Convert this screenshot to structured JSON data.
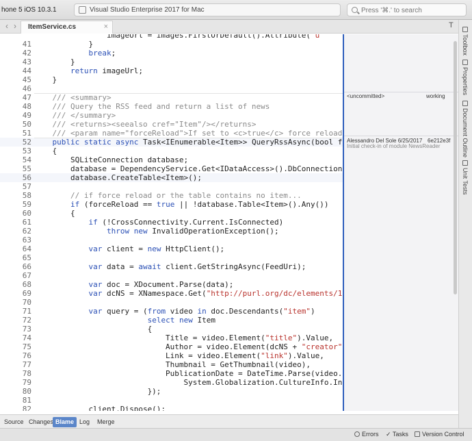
{
  "toolbar": {
    "device": "hone 5 iOS 10.3.1",
    "status": "Visual Studio Enterprise 2017 for Mac",
    "search_placeholder": "Press '⌘.' to search"
  },
  "tabbar": {
    "back": "‹",
    "forward": "›",
    "file_tab": "ItemService.cs",
    "close": "×",
    "panel_toggle": "T"
  },
  "sidebar": {
    "toolbox": "Toolbox",
    "properties": "Properties",
    "document_outline": "Document Outline",
    "unit_tests": "Unit Tests"
  },
  "editor": {
    "lines": [
      {
        "n": "",
        "t": "                imageUrl = images.FirstOrDefault().Attribute(\"u"
      },
      {
        "n": "41",
        "t": "            }"
      },
      {
        "n": "42",
        "t": "            break;"
      },
      {
        "n": "43",
        "t": "        }"
      },
      {
        "n": "44",
        "t": "        return imageUrl;"
      },
      {
        "n": "45",
        "t": "    }"
      },
      {
        "n": "46",
        "t": ""
      },
      {
        "n": "47",
        "t": "    /// <summary>"
      },
      {
        "n": "48",
        "t": "    /// Query the RSS feed and return a list of news"
      },
      {
        "n": "49",
        "t": "    /// </summary>"
      },
      {
        "n": "50",
        "t": "    /// <returns><seealso cref=\"Item\"/></returns>"
      },
      {
        "n": "51",
        "t": "    /// <param name=\"forceReload\">If set to <c>true</c> force reload"
      },
      {
        "n": "52",
        "t": "    public static async Task<IEnumerable<Item>> QueryRssAsync(bool f"
      },
      {
        "n": "53",
        "t": "    {"
      },
      {
        "n": "54",
        "t": "        SQLiteConnection database;"
      },
      {
        "n": "55",
        "t": "        database = DependencyService.Get<IDataAccess>().DbConnection"
      },
      {
        "n": "56",
        "t": "        database.CreateTable<Item>();"
      },
      {
        "n": "57",
        "t": ""
      },
      {
        "n": "58",
        "t": "        // if force reload or the table contains no item..."
      },
      {
        "n": "59",
        "t": "        if (forceReload == true || !database.Table<Item>().Any())"
      },
      {
        "n": "60",
        "t": "        {"
      },
      {
        "n": "61",
        "t": "            if (!CrossConnectivity.Current.IsConnected)"
      },
      {
        "n": "62",
        "t": "                throw new InvalidOperationException();"
      },
      {
        "n": "63",
        "t": ""
      },
      {
        "n": "64",
        "t": "            var client = new HttpClient();"
      },
      {
        "n": "65",
        "t": ""
      },
      {
        "n": "66",
        "t": "            var data = await client.GetStringAsync(FeedUri);"
      },
      {
        "n": "67",
        "t": ""
      },
      {
        "n": "68",
        "t": "            var doc = XDocument.Parse(data);"
      },
      {
        "n": "69",
        "t": "            var dcNS = XNamespace.Get(\"http://purl.org/dc/elements/1"
      },
      {
        "n": "70",
        "t": ""
      },
      {
        "n": "71",
        "t": "            var query = (from video in doc.Descendants(\"item\")"
      },
      {
        "n": "72",
        "t": "                         select new Item"
      },
      {
        "n": "73",
        "t": "                         {"
      },
      {
        "n": "74",
        "t": "                             Title = video.Element(\"title\").Value,"
      },
      {
        "n": "75",
        "t": "                             Author = video.Element(dcNS + \"creator\""
      },
      {
        "n": "76",
        "t": "                             Link = video.Element(\"link\").Value,"
      },
      {
        "n": "77",
        "t": "                             Thumbnail = GetThumbnail(video),"
      },
      {
        "n": "78",
        "t": "                             PublicationDate = DateTime.Parse(video."
      },
      {
        "n": "79",
        "t": "                                 System.Globalization.CultureInfo.In"
      },
      {
        "n": "80",
        "t": "                         });"
      },
      {
        "n": "81",
        "t": ""
      },
      {
        "n": "82",
        "t": "            client.Dispose();"
      }
    ]
  },
  "blame": {
    "uncommitted_label": "<uncommitted>",
    "uncommitted_status": "working",
    "author_date": "Alessandro Del Sole 6/25/2017",
    "hash": "6e212e3f",
    "message": "Initial check-in of module NewsReader"
  },
  "bottom_tabs": [
    "Source",
    "Changes",
    "Blame",
    "Log",
    "Merge"
  ],
  "statusbar": {
    "errors": "Errors",
    "tasks": "Tasks",
    "version_control": "Version Control"
  },
  "colors": {
    "keyword": "#2a4fb5",
    "string": "#b8322c",
    "comment": "#8a8a8a",
    "accent": "#5b86c9"
  }
}
